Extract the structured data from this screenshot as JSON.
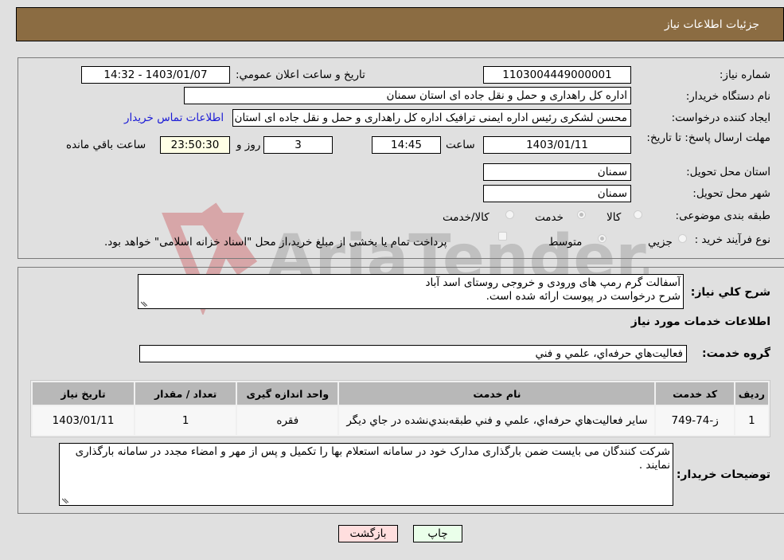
{
  "header": {
    "title": "جزئیات اطلاعات نیاز"
  },
  "form": {
    "need_number": {
      "label": "شماره نیاز:",
      "value": "1103004449000001"
    },
    "announce_datetime": {
      "label": "تاریخ و ساعت اعلان عمومي:",
      "value": "1403/01/07 - 14:32"
    },
    "buyer_org": {
      "label": "نام دستگاه خريدار:",
      "value": "اداره کل راهداری و حمل و نقل جاده ای استان سمنان"
    },
    "requester": {
      "label": "ايجاد کننده درخواست:",
      "value": "محسن لشکری رئیس اداره ایمنی ترافیک اداره کل راهداری و حمل و نقل جاده ای استان سمنان",
      "contact_link": "اطلاعات تماس خريدار"
    },
    "deadline": {
      "label": "مهلت ارسال پاسخ: تا تاريخ:",
      "date": "1403/01/11",
      "time_label": "ساعت",
      "time": "14:45",
      "days": "3",
      "days_label": "روز و",
      "remaining": "23:50:30",
      "remaining_label": "ساعت باقي مانده"
    },
    "province": {
      "label": "استان محل تحويل:",
      "value": "سمنان"
    },
    "city": {
      "label": "شهر محل تحويل:",
      "value": "سمنان"
    },
    "category": {
      "label": "طبقه بندی موضوعی:",
      "options": [
        {
          "label": "کالا",
          "checked": false
        },
        {
          "label": "خدمت",
          "checked": true
        },
        {
          "label": "کالا/خدمت",
          "checked": false
        }
      ]
    },
    "purchase_type": {
      "label": "نوع فرآيند خريد :",
      "options": [
        {
          "label": "جزيي",
          "checked": false
        },
        {
          "label": "متوسط",
          "checked": true
        }
      ],
      "treasury_note": "پرداخت تمام يا بخشی از مبلغ خريد،از محل \"اسناد خزانه اسلامی\" خواهد بود."
    }
  },
  "description": {
    "label": "شرح کلي نياز:",
    "lines": [
      "آسفالت گرم رمپ های ورودی و خروجی روستای اسد آباد",
      "شرح درخواست در پیوست ارائه شده است."
    ]
  },
  "services": {
    "title": "اطلاعات خدمات مورد نياز",
    "group_label": "گروه خدمت:",
    "group_value": "فعاليت‌هاي حرفه‌اي، علمي و فني",
    "table": {
      "headers": [
        "رديف",
        "کد خدمت",
        "نام خدمت",
        "واحد اندازه گيری",
        "تعداد / مقدار",
        "تاريخ نياز"
      ],
      "rows": [
        [
          "1",
          "ز-74-749",
          "ساير فعاليت‌هاي حرفه‌اي، علمي و فني طبقه‌بندي‌نشده در جاي ديگر",
          "فقره",
          "1",
          "1403/01/11"
        ]
      ]
    }
  },
  "buyer_notes": {
    "label": "توضيحات خريدار:",
    "text": "شرکت کنندگان می بایست ضمن بارگذاری مدارک خود در سامانه استعلام بها را تکمیل و پس از مهر و امضاء مجدد در سامانه بارگذاری نمایند ."
  },
  "buttons": {
    "print": "چاپ",
    "back": "بازگشت"
  },
  "watermark": {
    "text": "AriaTender.neT"
  },
  "colors": {
    "header_bg": "#8b6c42",
    "link": "#1a1ad6",
    "print_bg": "#eaffea",
    "back_bg": "#ffdede",
    "remaining_bg": "#ffffe6"
  }
}
